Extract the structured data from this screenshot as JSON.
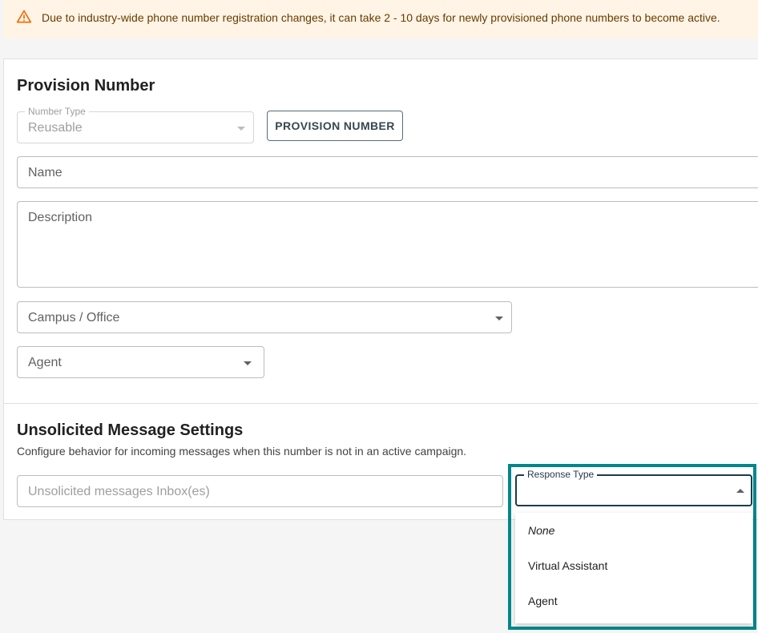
{
  "banner": {
    "icon": "warning-icon",
    "message": "Due to industry-wide phone number registration changes, it can take 2 - 10 days for newly provisioned phone numbers to become active."
  },
  "provision": {
    "title": "Provision Number",
    "number_type_label": "Number Type",
    "number_type_value": "Reusable",
    "provision_button": "PROVISION NUMBER",
    "name_placeholder": "Name",
    "description_placeholder": "Description",
    "campus_placeholder": "Campus / Office",
    "agent_placeholder": "Agent"
  },
  "unsolicited": {
    "title": "Unsolicited Message Settings",
    "subtitle": "Configure behavior for incoming messages when this number is not in an active campaign.",
    "inbox_placeholder": "Unsolicited messages Inbox(es)",
    "response_type_label": "Response Type",
    "response_options": [
      "None",
      "Virtual Assistant",
      "Agent"
    ]
  },
  "colors": {
    "banner_bg": "#fff4e5",
    "warning": "#ed6c02",
    "highlight": "#00868b",
    "focused_border": "#1f3a4d"
  }
}
